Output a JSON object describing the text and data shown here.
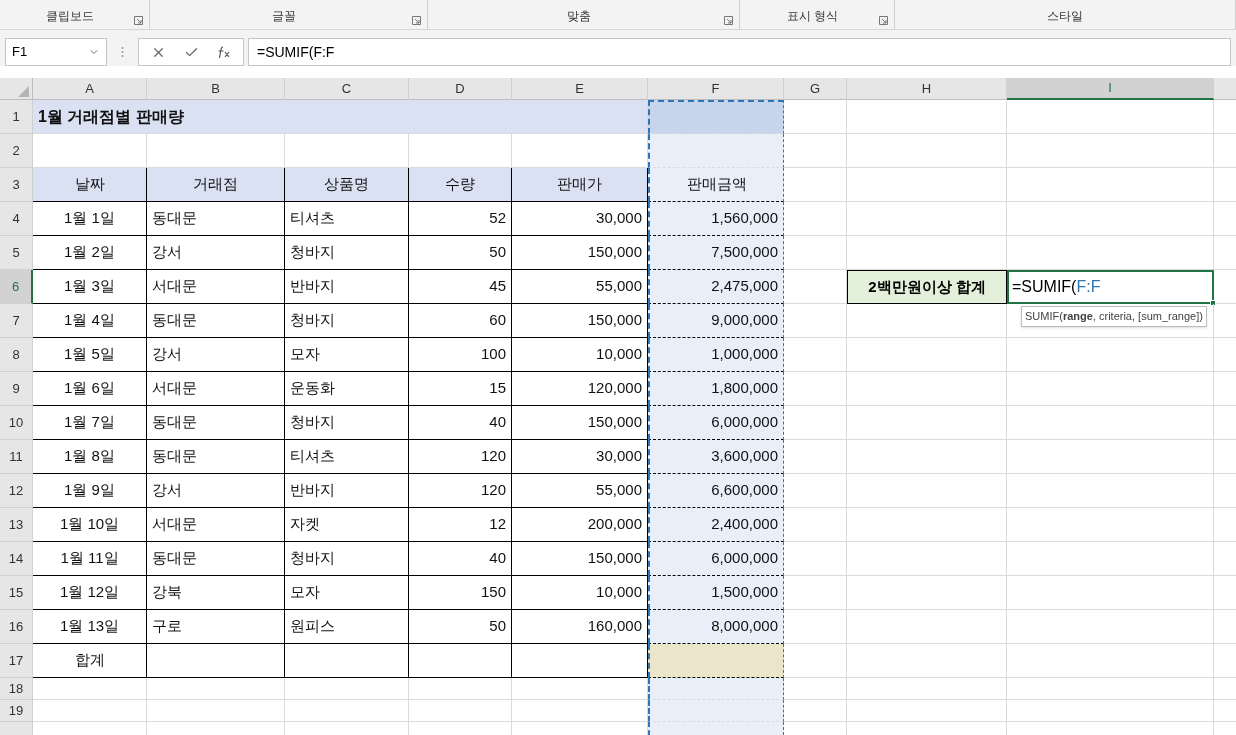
{
  "ribbon_groups": [
    {
      "label": "클립보드",
      "launcher": true
    },
    {
      "label": "글꼴",
      "launcher": true
    },
    {
      "label": "맞춤",
      "launcher": true
    },
    {
      "label": "표시 형식",
      "launcher": true
    },
    {
      "label": "스타일",
      "launcher": false
    }
  ],
  "name_box": "F1",
  "formula_bar": {
    "text": "=SUMIF(F:F"
  },
  "columns": [
    {
      "label": "A",
      "selected": false,
      "referenced": false
    },
    {
      "label": "B",
      "selected": false,
      "referenced": false
    },
    {
      "label": "C",
      "selected": false,
      "referenced": false
    },
    {
      "label": "D",
      "selected": false,
      "referenced": false
    },
    {
      "label": "E",
      "selected": false,
      "referenced": false
    },
    {
      "label": "F",
      "selected": false,
      "referenced": true
    },
    {
      "label": "G",
      "selected": false,
      "referenced": false
    },
    {
      "label": "H",
      "selected": false,
      "referenced": false
    },
    {
      "label": "I",
      "selected": true,
      "referenced": false
    }
  ],
  "rows": [
    {
      "number": "1",
      "selected": false,
      "kind": "title",
      "cells": {
        "A": "1월 거래점별 판매량"
      }
    },
    {
      "number": "2",
      "selected": false,
      "kind": "blank",
      "cells": {}
    },
    {
      "number": "3",
      "selected": false,
      "kind": "header",
      "cells": {
        "A": "날짜",
        "B": "거래점",
        "C": "상품명",
        "D": "수량",
        "E": "판매가",
        "F": "판매금액"
      }
    },
    {
      "number": "4",
      "selected": false,
      "kind": "data",
      "cells": {
        "A": "1월 1일",
        "B": "동대문",
        "C": "티셔츠",
        "D": "52",
        "E": "30,000",
        "F": "1,560,000"
      }
    },
    {
      "number": "5",
      "selected": false,
      "kind": "data",
      "cells": {
        "A": "1월 2일",
        "B": "강서",
        "C": "청바지",
        "D": "50",
        "E": "150,000",
        "F": "7,500,000"
      }
    },
    {
      "number": "6",
      "selected": true,
      "kind": "data",
      "cells": {
        "A": "1월 3일",
        "B": "서대문",
        "C": "반바지",
        "D": "45",
        "E": "55,000",
        "F": "2,475,000"
      },
      "side": {
        "label": "2백만원이상 합계",
        "formula": "=SUMIF(",
        "range_ref": "F:F",
        "tooltip": "SUMIF(**range**, criteria, [sum_range])"
      }
    },
    {
      "number": "7",
      "selected": false,
      "kind": "data",
      "cells": {
        "A": "1월 4일",
        "B": "동대문",
        "C": "청바지",
        "D": "60",
        "E": "150,000",
        "F": "9,000,000"
      }
    },
    {
      "number": "8",
      "selected": false,
      "kind": "data",
      "cells": {
        "A": "1월 5일",
        "B": "강서",
        "C": "모자",
        "D": "100",
        "E": "10,000",
        "F": "1,000,000"
      }
    },
    {
      "number": "9",
      "selected": false,
      "kind": "data",
      "cells": {
        "A": "1월 6일",
        "B": "서대문",
        "C": "운동화",
        "D": "15",
        "E": "120,000",
        "F": "1,800,000"
      }
    },
    {
      "number": "10",
      "selected": false,
      "kind": "data",
      "cells": {
        "A": "1월 7일",
        "B": "동대문",
        "C": "청바지",
        "D": "40",
        "E": "150,000",
        "F": "6,000,000"
      }
    },
    {
      "number": "11",
      "selected": false,
      "kind": "data",
      "cells": {
        "A": "1월 8일",
        "B": "동대문",
        "C": "티셔츠",
        "D": "120",
        "E": "30,000",
        "F": "3,600,000"
      }
    },
    {
      "number": "12",
      "selected": false,
      "kind": "data",
      "cells": {
        "A": "1월 9일",
        "B": "강서",
        "C": "반바지",
        "D": "120",
        "E": "55,000",
        "F": "6,600,000"
      }
    },
    {
      "number": "13",
      "selected": false,
      "kind": "data",
      "cells": {
        "A": "1월 10일",
        "B": "서대문",
        "C": "자켓",
        "D": "12",
        "E": "200,000",
        "F": "2,400,000"
      }
    },
    {
      "number": "14",
      "selected": false,
      "kind": "data",
      "cells": {
        "A": "1월 11일",
        "B": "동대문",
        "C": "청바지",
        "D": "40",
        "E": "150,000",
        "F": "6,000,000"
      }
    },
    {
      "number": "15",
      "selected": false,
      "kind": "data",
      "cells": {
        "A": "1월 12일",
        "B": "강북",
        "C": "모자",
        "D": "150",
        "E": "10,000",
        "F": "1,500,000"
      }
    },
    {
      "number": "16",
      "selected": false,
      "kind": "data",
      "cells": {
        "A": "1월 13일",
        "B": "구로",
        "C": "원피스",
        "D": "50",
        "E": "160,000",
        "F": "8,000,000"
      }
    },
    {
      "number": "17",
      "selected": false,
      "kind": "total",
      "cells": {
        "A": "합계"
      }
    },
    {
      "number": "18",
      "selected": false,
      "kind": "small",
      "cells": {}
    },
    {
      "number": "19",
      "selected": false,
      "kind": "small",
      "cells": {}
    }
  ]
}
